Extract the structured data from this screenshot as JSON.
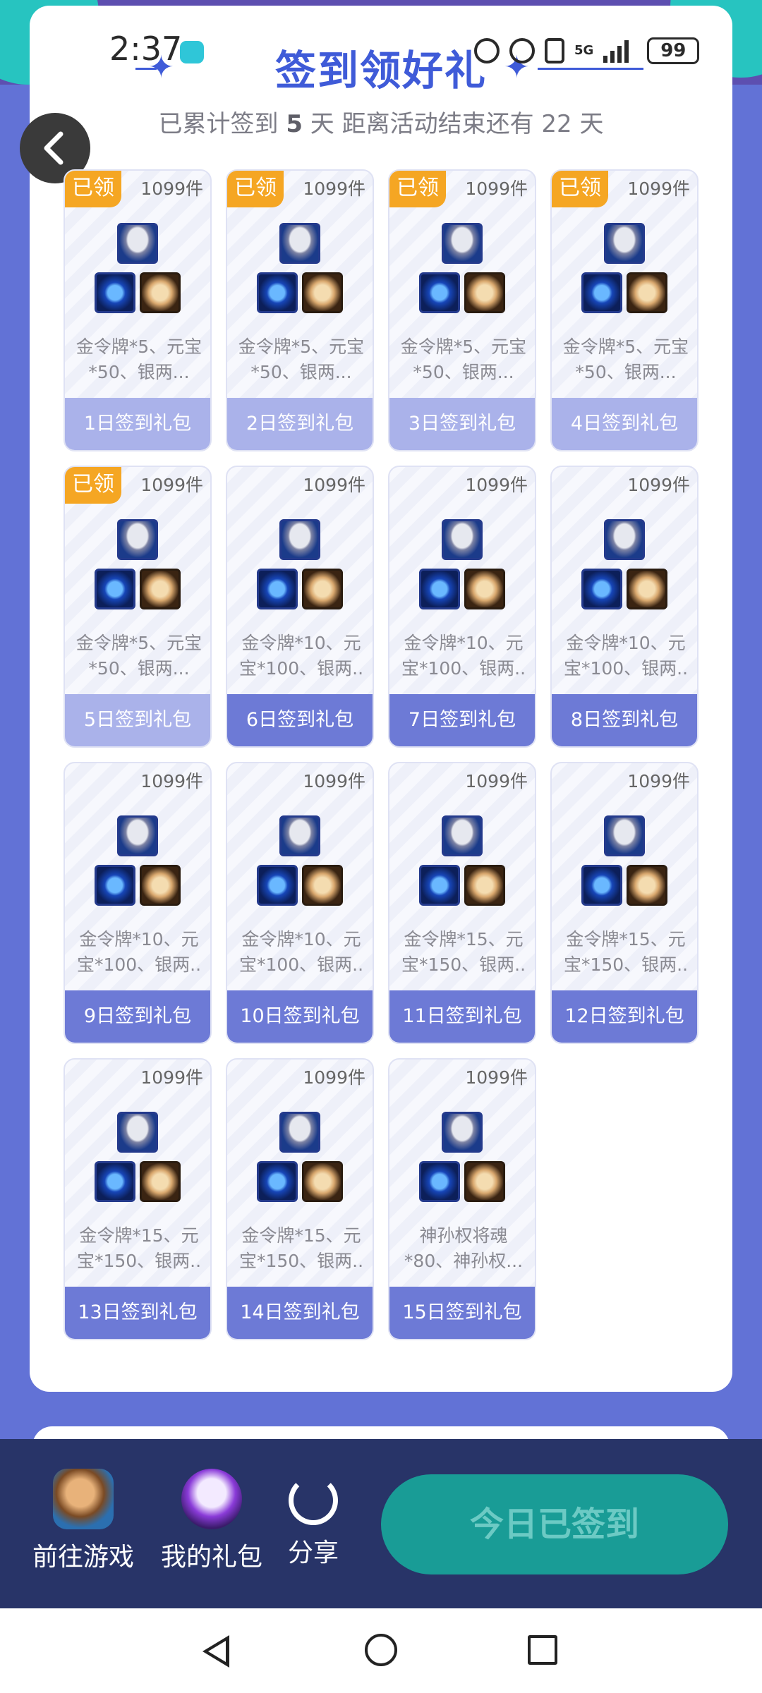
{
  "status_bar": {
    "time": "2:37",
    "battery": "99",
    "network": "5G"
  },
  "header": {
    "title": "签到领好礼",
    "summary_prefix": "已累计签到",
    "days_signed": "5",
    "summary_mid": "天  距离活动结束还有",
    "days_left": "22",
    "summary_suffix": "天"
  },
  "gifts": [
    {
      "count": "1099件",
      "claimed_tag": "已领",
      "desc_1": "金令牌*5、元宝",
      "desc_2": "*50、银两...",
      "label": "1日签到礼包"
    },
    {
      "count": "1099件",
      "claimed_tag": "已领",
      "desc_1": "金令牌*5、元宝",
      "desc_2": "*50、银两...",
      "label": "2日签到礼包"
    },
    {
      "count": "1099件",
      "claimed_tag": "已领",
      "desc_1": "金令牌*5、元宝",
      "desc_2": "*50、银两...",
      "label": "3日签到礼包"
    },
    {
      "count": "1099件",
      "claimed_tag": "已领",
      "desc_1": "金令牌*5、元宝",
      "desc_2": "*50、银两...",
      "label": "4日签到礼包"
    },
    {
      "count": "1099件",
      "claimed_tag": "已领",
      "desc_1": "金令牌*5、元宝",
      "desc_2": "*50、银两...",
      "label": "5日签到礼包"
    },
    {
      "count": "1099件",
      "desc_1": "金令牌*10、元",
      "desc_2": "宝*100、银两..",
      "label": "6日签到礼包"
    },
    {
      "count": "1099件",
      "desc_1": "金令牌*10、元",
      "desc_2": "宝*100、银两..",
      "label": "7日签到礼包"
    },
    {
      "count": "1099件",
      "desc_1": "金令牌*10、元",
      "desc_2": "宝*100、银两..",
      "label": "8日签到礼包"
    },
    {
      "count": "1099件",
      "desc_1": "金令牌*10、元",
      "desc_2": "宝*100、银两..",
      "label": "9日签到礼包"
    },
    {
      "count": "1099件",
      "desc_1": "金令牌*10、元",
      "desc_2": "宝*100、银两..",
      "label": "10日签到礼包"
    },
    {
      "count": "1099件",
      "desc_1": "金令牌*15、元",
      "desc_2": "宝*150、银两..",
      "label": "11日签到礼包"
    },
    {
      "count": "1099件",
      "desc_1": "金令牌*15、元",
      "desc_2": "宝*150、银两..",
      "label": "12日签到礼包"
    },
    {
      "count": "1099件",
      "desc_1": "金令牌*15、元",
      "desc_2": "宝*150、银两..",
      "label": "13日签到礼包"
    },
    {
      "count": "1099件",
      "desc_1": "金令牌*15、元",
      "desc_2": "宝*150、银两..",
      "label": "14日签到礼包"
    },
    {
      "count": "1099件",
      "desc_1": "神孙权将魂",
      "desc_2": "*80、神孙权...",
      "label": "15日签到礼包"
    }
  ],
  "bottom_bar": {
    "go_game": "前往游戏",
    "my_gifts": "我的礼包",
    "share": "分享",
    "checkin_button": "今日已签到"
  },
  "colors": {
    "accent": "#3f5bd8",
    "claimed_tag": "#f5a623",
    "label_active": "#6d7ad6",
    "label_done": "#aab2ea",
    "checkin_button": "#199c96"
  }
}
